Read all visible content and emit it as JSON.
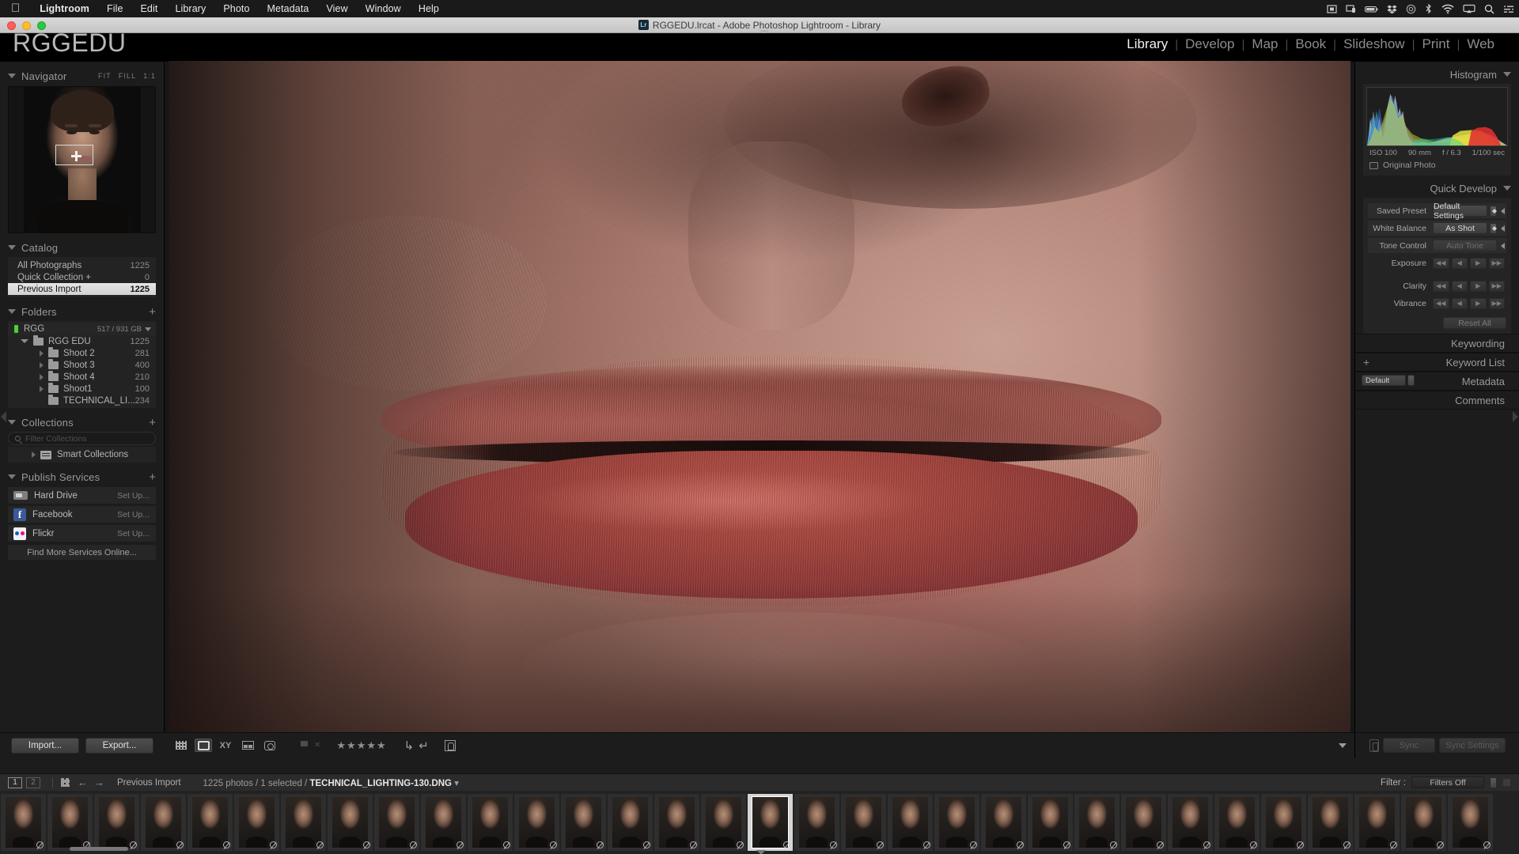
{
  "os_menubar": {
    "apple": "apple-logo",
    "items": [
      "Lightroom",
      "File",
      "Edit",
      "Library",
      "Photo",
      "Metadata",
      "View",
      "Window",
      "Help"
    ],
    "status_icons": [
      "screen-record-icon",
      "display-icon",
      "battery-icon",
      "dropbox-icon",
      "creative-cloud-icon",
      "bluetooth-icon",
      "wifi-icon",
      "airplay-icon",
      "search-icon",
      "control-center-icon"
    ]
  },
  "window": {
    "title": "RGGEDU.lrcat - Adobe Photoshop Lightroom - Library",
    "app_badge": "Lr",
    "traffic_lights": [
      "close",
      "minimize",
      "zoom"
    ]
  },
  "identity": {
    "plate": "RGGEDU"
  },
  "modules": {
    "items": [
      "Library",
      "Develop",
      "Map",
      "Book",
      "Slideshow",
      "Print",
      "Web"
    ],
    "active": "Library",
    "separator": "|"
  },
  "left_panel": {
    "navigator": {
      "title": "Navigator",
      "zoom_levels": [
        "FIT",
        "FILL",
        "1:1"
      ],
      "active_zoom": "1:1"
    },
    "catalog": {
      "title": "Catalog",
      "rows": [
        {
          "label": "All Photographs",
          "count": "1225",
          "selected": false
        },
        {
          "label": "Quick Collection  +",
          "count": "0",
          "selected": false
        },
        {
          "label": "Previous Import",
          "count": "1225",
          "selected": true
        }
      ]
    },
    "folders": {
      "title": "Folders",
      "add_label": "+",
      "volume": {
        "name": "RGG",
        "size": "517 / 931 GB"
      },
      "rows": [
        {
          "label": "RGG EDU",
          "count": "1225",
          "level": 1,
          "expanded": true
        },
        {
          "label": "Shoot 2",
          "count": "281",
          "level": 2,
          "expanded": false
        },
        {
          "label": "Shoot 3",
          "count": "400",
          "level": 2,
          "expanded": false
        },
        {
          "label": "Shoot 4",
          "count": "210",
          "level": 2,
          "expanded": false
        },
        {
          "label": "Shoot1",
          "count": "100",
          "level": 2,
          "expanded": false
        },
        {
          "label": "TECHNICAL_LI...",
          "count": "234",
          "level": 2,
          "expanded": false
        }
      ]
    },
    "collections": {
      "title": "Collections",
      "add_label": "+",
      "filter_placeholder": "Filter Collections",
      "smart_collections_label": "Smart Collections"
    },
    "publish_services": {
      "title": "Publish Services",
      "add_label": "+",
      "services": [
        {
          "name": "Hard Drive",
          "action": "Set Up...",
          "icon": "hard-drive-icon"
        },
        {
          "name": "Facebook",
          "action": "Set Up...",
          "icon": "facebook-icon"
        },
        {
          "name": "Flickr",
          "action": "Set Up...",
          "icon": "flickr-icon"
        }
      ],
      "find_more": "Find More Services Online..."
    },
    "buttons": {
      "import": "Import...",
      "export": "Export..."
    }
  },
  "right_panel": {
    "histogram": {
      "title": "Histogram",
      "iso": "ISO 100",
      "focal_length": "90 mm",
      "aperture": "f / 6.3",
      "shutter": "1/100 sec",
      "original_photo": "Original Photo"
    },
    "quick_develop": {
      "title": "Quick Develop",
      "saved_preset_label": "Saved Preset",
      "saved_preset_value": "Default Settings",
      "white_balance_label": "White Balance",
      "white_balance_value": "As Shot",
      "tone_control_label": "Tone Control",
      "auto_tone_label": "Auto Tone",
      "sliders": [
        "Exposure",
        "Clarity",
        "Vibrance"
      ],
      "reset_all": "Reset All"
    },
    "sections": [
      {
        "title": "Keywording",
        "has_plus": false,
        "has_preset": false
      },
      {
        "title": "Keyword List",
        "has_plus": true,
        "has_preset": false
      },
      {
        "title": "Metadata",
        "has_plus": false,
        "has_preset": true,
        "preset_value": "Default"
      },
      {
        "title": "Comments",
        "has_plus": false,
        "has_preset": false
      }
    ],
    "sync": {
      "sync_label": "Sync",
      "sync_settings_label": "Sync Settings"
    }
  },
  "toolbar": {
    "view_modes": [
      {
        "name": "grid-view-icon",
        "active": false
      },
      {
        "name": "loupe-view-icon",
        "active": true
      },
      {
        "name": "compare-view-icon",
        "active": false,
        "label": "XY"
      },
      {
        "name": "survey-view-icon",
        "active": false
      },
      {
        "name": "people-view-icon",
        "active": false
      }
    ],
    "flags": [
      "flag-pick-icon",
      "flag-reject-icon"
    ],
    "rating_stars": "★★★★★",
    "rotate_left": "rotate-left-icon",
    "rotate_right": "rotate-right-icon",
    "crop_overlay": "crop-overlay-icon",
    "dropdown": "toolbar-chevron-icon"
  },
  "filmstrip_bar": {
    "screen_one": "1",
    "screen_two": "2",
    "grid_icon": "grid-icon",
    "back_arrow": "←",
    "forward_arrow": "→",
    "source": "Previous Import",
    "photo_count": "1225 photos / 1 selected /",
    "filename": "TECHNICAL_LIGHTING-130.DNG",
    "filename_caret": "▾",
    "filter_label": "Filter :",
    "filter_value": "Filters Off"
  },
  "filmstrip": {
    "thumb_count": 32,
    "selected_index": 16
  },
  "colors": {
    "panel_bg": "#1c1c1c",
    "panel_inner": "#242424",
    "selected_row": "#e6e6e6",
    "text": "#b4b4b4",
    "accent_green": "#4cd137",
    "facebook": "#3b5998",
    "flickr_blue": "#0063dc",
    "flickr_pink": "#ff0084"
  }
}
